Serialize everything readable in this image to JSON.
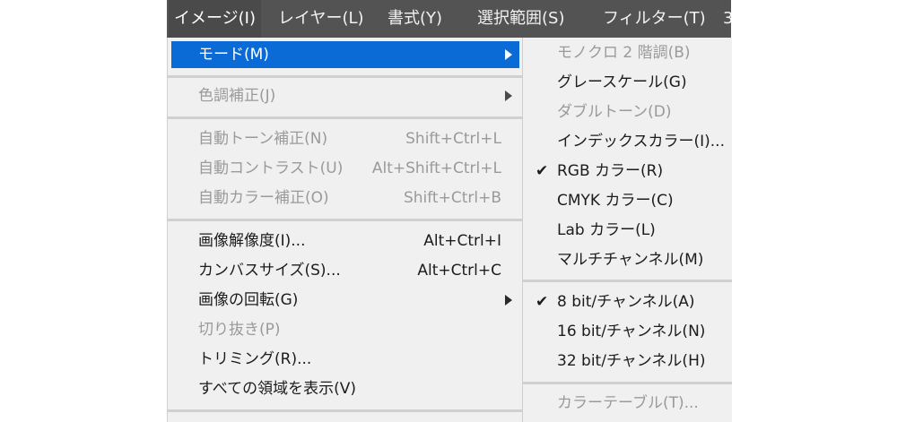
{
  "menubar": {
    "items": [
      {
        "label": "イメージ(I)"
      },
      {
        "label": "レイヤー(L)"
      },
      {
        "label": "書式(Y)"
      },
      {
        "label": "選択範囲(S)"
      },
      {
        "label": "フィルター(T)"
      },
      {
        "label": "3"
      }
    ]
  },
  "image_menu": {
    "mode": "モード(M)",
    "adjustments": "色調補正(J)",
    "auto_tone": {
      "label": "自動トーン補正(N)",
      "shortcut": "Shift+Ctrl+L"
    },
    "auto_contrast": {
      "label": "自動コントラスト(U)",
      "shortcut": "Alt+Shift+Ctrl+L"
    },
    "auto_color": {
      "label": "自動カラー補正(O)",
      "shortcut": "Shift+Ctrl+B"
    },
    "image_size": {
      "label": "画像解像度(I)...",
      "shortcut": "Alt+Ctrl+I"
    },
    "canvas_size": {
      "label": "カンバスサイズ(S)...",
      "shortcut": "Alt+Ctrl+C"
    },
    "rotation": "画像の回転(G)",
    "crop": "切り抜き(P)",
    "trim": "トリミング(R)...",
    "reveal_all": "すべての領域を表示(V)"
  },
  "mode_submenu": {
    "bitmap": "モノクロ 2 階調(B)",
    "grayscale": "グレースケール(G)",
    "duotone": "ダブルトーン(D)",
    "indexed": "インデックスカラー(I)...",
    "rgb": "RGB カラー(R)",
    "cmyk": "CMYK カラー(C)",
    "lab": "Lab カラー(L)",
    "multichannel": "マルチチャンネル(M)",
    "bit8": "8 bit/チャンネル(A)",
    "bit16": "16 bit/チャンネル(N)",
    "bit32": "32 bit/チャンネル(H)",
    "color_table": "カラーテーブル(T)...",
    "check_glyph": "✔"
  }
}
